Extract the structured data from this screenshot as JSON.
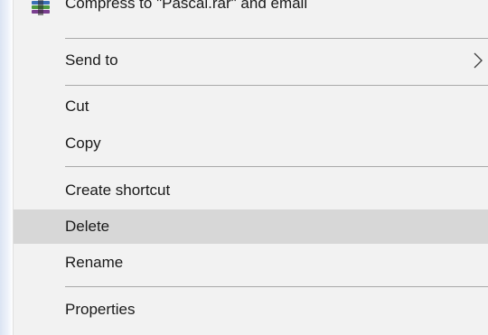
{
  "context_menu": {
    "items": [
      {
        "label": "Compress to \"Pascal.rar\" and email",
        "icon": "winrar-archive-icon"
      },
      {
        "label": "Send to",
        "submenu_icon": "chevron-right-icon"
      },
      {
        "label": "Cut"
      },
      {
        "label": "Copy"
      },
      {
        "label": "Create shortcut"
      },
      {
        "label": "Delete",
        "state": "highlighted"
      },
      {
        "label": "Rename"
      },
      {
        "label": "Properties"
      }
    ],
    "colors": {
      "background": "#f2f2f2",
      "highlight": "#d7d7d7",
      "separator": "#a9a9a9",
      "text": "#1a1a1a"
    }
  }
}
